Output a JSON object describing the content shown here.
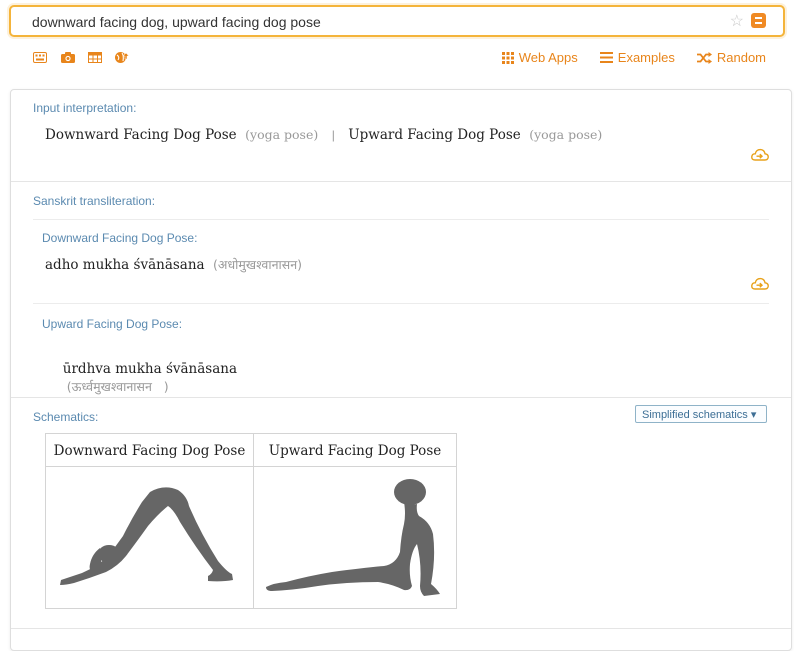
{
  "search": {
    "query": "downward facing dog, upward facing dog pose"
  },
  "toolbar": {
    "icons": [
      "keyboard-icon",
      "camera-icon",
      "table-icon",
      "globe-upload-icon"
    ],
    "web_apps_label": "Web Apps",
    "examples_label": "Examples",
    "random_label": "Random"
  },
  "input_interpretation": {
    "title": "Input interpretation:",
    "item1_name": "Downward Facing Dog Pose",
    "item1_type": "(yoga pose)",
    "separator": "|",
    "item2_name": "Upward Facing Dog Pose",
    "item2_type": "(yoga pose)"
  },
  "sanskrit": {
    "title": "Sanskrit transliteration:",
    "downward": {
      "label": "Downward Facing Dog Pose:",
      "roman": "adho mukha śvānāsana",
      "devanagari": "(अधोमुखश्वानासन)"
    },
    "upward": {
      "label": "Upward Facing Dog Pose:",
      "roman": "ūrdhva mukha śvānāsana",
      "devanagari": "(ऊर्ध्वमुखश्वानासन   )"
    }
  },
  "schematics": {
    "title": "Schematics:",
    "dropdown_label": "Simplified schematics ▾",
    "col1_header": "Downward Facing Dog Pose",
    "col2_header": "Upward Facing Dog Pose"
  },
  "colors": {
    "accent": "#f4b43b",
    "link": "#e8851b",
    "section_title": "#5b8ab0",
    "pose_fill": "#666666"
  }
}
